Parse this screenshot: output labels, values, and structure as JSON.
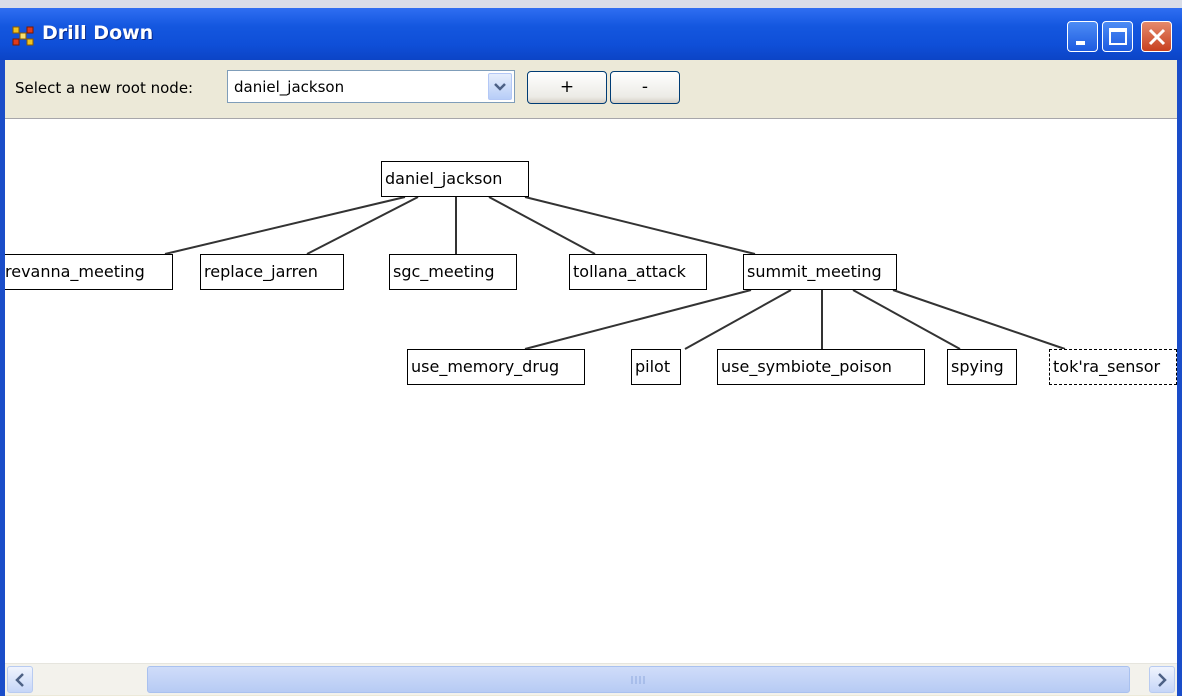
{
  "window": {
    "title": "Drill Down",
    "controls": [
      "minimize",
      "maximize",
      "close"
    ]
  },
  "toolbar": {
    "root_label": "Select a new root node:",
    "root_value": "daniel_jackson",
    "plus_label": "+",
    "minus_label": "-"
  },
  "tree": {
    "root": "daniel_jackson",
    "children": [
      "revanna_meeting",
      "replace_jarren",
      "sgc_meeting",
      "tollana_attack",
      "summit_meeting"
    ],
    "summit_children": [
      "use_memory_drug",
      "pilot",
      "use_symbiote_poison",
      "spying",
      "tok'ra_sensor"
    ],
    "labels": {
      "daniel_jackson": "daniel_jackson",
      "revanna_meeting": "revanna_meeting",
      "replace_jarren": "replace_jarren",
      "sgc_meeting": "sgc_meeting",
      "tollana_attack": "tollana_attack",
      "summit_meeting": "summit_meeting",
      "use_memory_drug": "use_memory_drug",
      "pilot": "pilot",
      "use_symbiote_poison": "use_symbiote_poison",
      "spying": "spying",
      "tok_ra_sensor": "tok'ra_sensor"
    },
    "selected": "tok'ra_sensor"
  },
  "icons": {
    "app": "app-network-icon",
    "dropdown": "chevron-down-icon",
    "scroll_left": "arrow-left-icon",
    "scroll_right": "arrow-right-icon"
  },
  "colors": {
    "titlebar": "#0f4fd8",
    "close_button": "#c8401f",
    "client_bg": "#ece9d8"
  }
}
